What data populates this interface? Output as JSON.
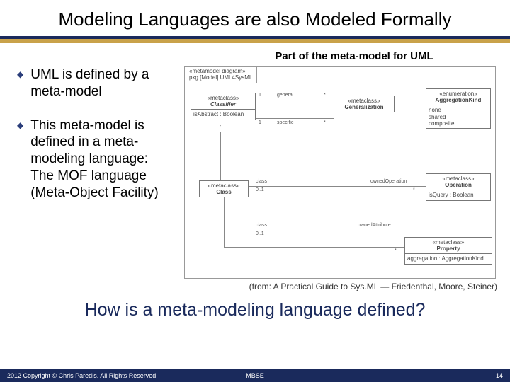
{
  "title": "Modeling Languages are also Modeled Formally",
  "subtitle": "Part of the meta-model for  UML",
  "bullets": [
    "UML is defined by a meta-model",
    "This meta-model is defined in a meta-modeling language:\nThe MOF language (Meta-Object Facility)"
  ],
  "diagram": {
    "tab_line1": "«metamodel diagram»",
    "tab_line2": "pkg [Model] UML4SysML",
    "classifier": {
      "stereo": "«metaclass»",
      "name": "Classifier",
      "attr": "isAbstract : Boolean"
    },
    "class": {
      "stereo": "«metaclass»",
      "name": "Class"
    },
    "generalization": {
      "stereo": "«metaclass»",
      "name": "Generalization"
    },
    "aggkind": {
      "stereo": "«enumeration»",
      "name": "AggregationKind",
      "v1": "none",
      "v2": "shared",
      "v3": "composite"
    },
    "operation": {
      "stereo": "«metaclass»",
      "name": "Operation",
      "attr": "isQuery : Boolean"
    },
    "property": {
      "stereo": "«metaclass»",
      "name": "Property",
      "attr": "aggregation : AggregationKind"
    },
    "labels": {
      "one_a": "1",
      "one_b": "1",
      "star_a": "*",
      "star_b": "*",
      "general": "general",
      "specific": "specific",
      "class_a": "class",
      "class_b": "class",
      "zz1": "0..1",
      "zz2": "0..1",
      "ownedOp": "ownedOperation",
      "ownedAttr": "ownedAttribute"
    }
  },
  "citation": "(from: A Practical Guide to Sys.ML — Friedenthal, Moore, Steiner)",
  "question": "How is a meta-modeling language defined?",
  "footer": {
    "left": "2012 Copyright © Chris Paredis. All Rights Reserved.",
    "center": "MBSE",
    "right": "14"
  }
}
